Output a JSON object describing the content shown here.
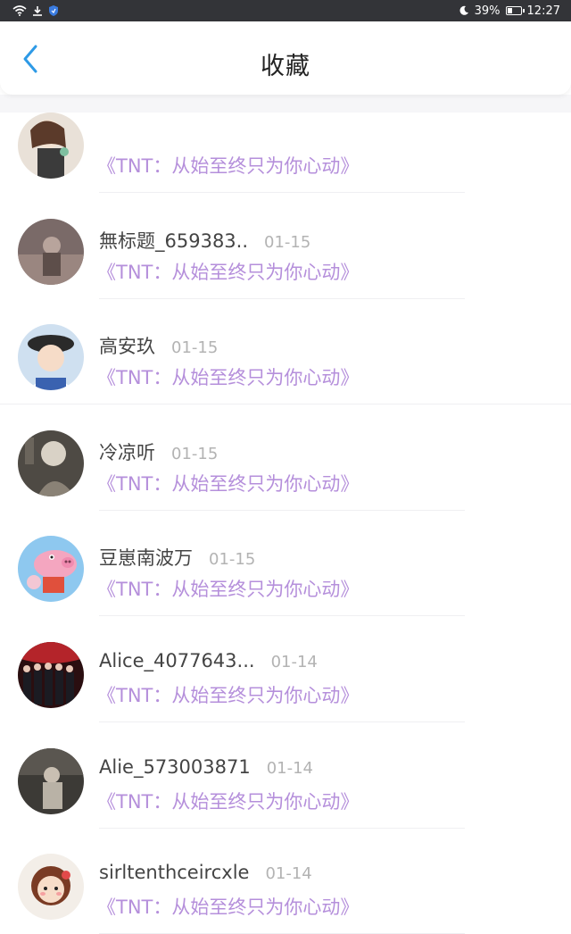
{
  "status_bar": {
    "battery": "39%",
    "time": "12:27",
    "battery_level": 0.39
  },
  "header": {
    "title": "收藏"
  },
  "items": [
    {
      "name": "",
      "date": "",
      "snippet": "《TNT：从始至终只为你心动》"
    },
    {
      "name": "無标题_659383..",
      "date": "01-15",
      "snippet": "《TNT：从始至终只为你心动》"
    },
    {
      "name": "高安玖",
      "date": "01-15",
      "snippet": "《TNT：从始至终只为你心动》"
    },
    {
      "name": "冷凉听",
      "date": "01-15",
      "snippet": "《TNT：从始至终只为你心动》"
    },
    {
      "name": "豆崽南波万",
      "date": "01-15",
      "snippet": "《TNT：从始至终只为你心动》"
    },
    {
      "name": "Alice_4077643...",
      "date": "01-14",
      "snippet": "《TNT：从始至终只为你心动》"
    },
    {
      "name": "Alie_573003871",
      "date": "01-14",
      "snippet": "《TNT：从始至终只为你心动》"
    },
    {
      "name": "sirltenthceircxle",
      "date": "01-14",
      "snippet": "《TNT：从始至终只为你心动》"
    }
  ],
  "colors": {
    "accent": "#2e9ae6",
    "snippet": "#b58fdb",
    "date": "#b3b3b3",
    "name": "#444444"
  }
}
